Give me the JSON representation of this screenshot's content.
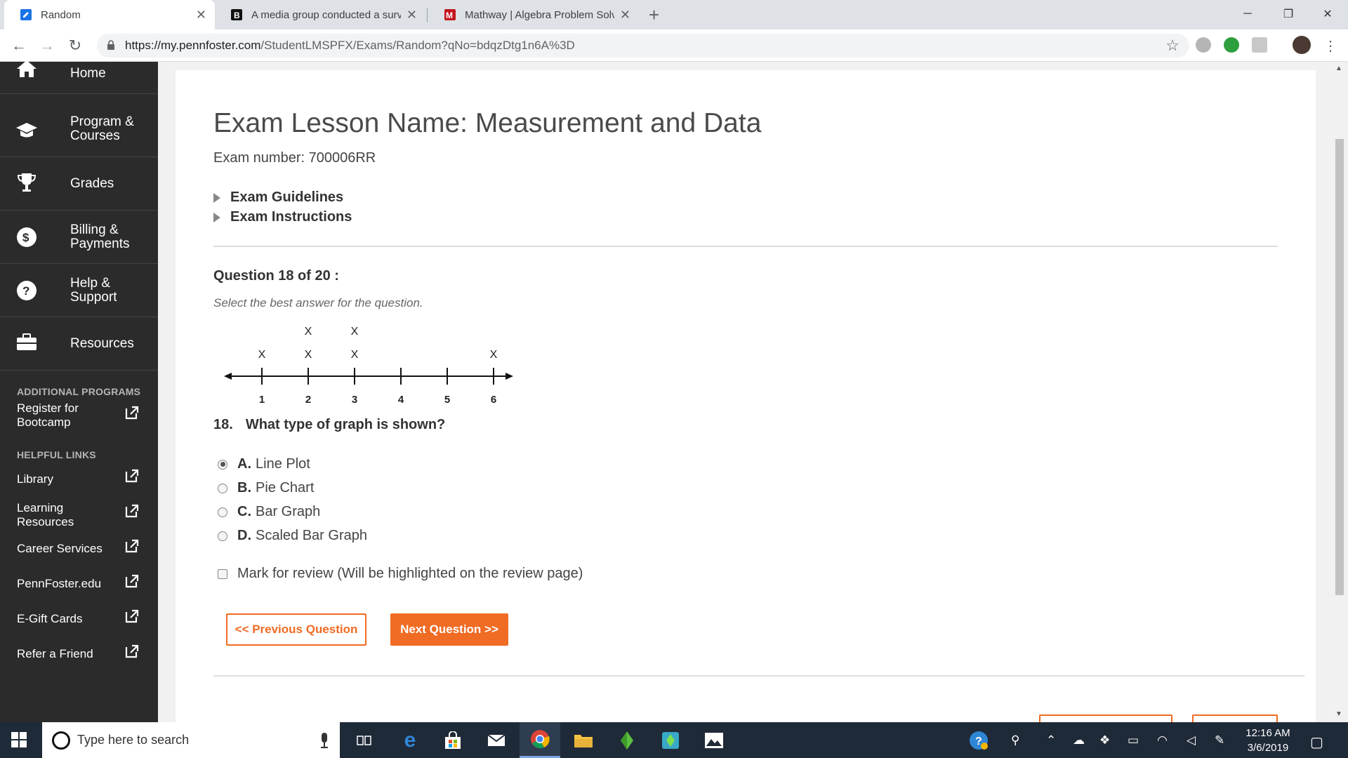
{
  "browser": {
    "tabs": [
      {
        "title": "Random",
        "active": true
      },
      {
        "title": "A media group conducted a surv",
        "active": false
      },
      {
        "title": "Mathway | Algebra Problem Solv",
        "active": false
      }
    ],
    "url_host": "https://my.pennfoster.com",
    "url_path": "/StudentLMSPFX/Exams/Random?qNo=bdqzDtg1n6A%3D"
  },
  "sidebar": {
    "nav": [
      {
        "label": "Home",
        "icon": "home-icon"
      },
      {
        "label": "Program & Courses",
        "icon": "graduation-cap-icon"
      },
      {
        "label": "Grades",
        "icon": "trophy-icon"
      },
      {
        "label": "Billing & Payments",
        "icon": "dollar-icon"
      },
      {
        "label": "Help & Support",
        "icon": "question-icon"
      },
      {
        "label": "Resources",
        "icon": "briefcase-icon"
      }
    ],
    "additional_heading": "ADDITIONAL PROGRAMS",
    "bootcamp": "Register for Bootcamp",
    "helpful_heading": "HELPFUL LINKS",
    "links": [
      "Library",
      "Learning Resources",
      "Career Services",
      "PennFoster.edu",
      "E-Gift Cards",
      "Refer a Friend"
    ]
  },
  "exam": {
    "title": "Exam Lesson Name: Measurement and Data",
    "number": "Exam number: 700006RR",
    "guidelines": "Exam Guidelines",
    "instructions": "Exam Instructions",
    "question_header": "Question 18 of 20 :",
    "instruction_text": "Select the best answer for the question.",
    "question_number": "18.",
    "question_text": "What type of graph is shown?",
    "options": [
      {
        "letter": "A.",
        "text": "Line Plot",
        "selected": true
      },
      {
        "letter": "B.",
        "text": "Pie Chart",
        "selected": false
      },
      {
        "letter": "C.",
        "text": "Bar Graph",
        "selected": false
      },
      {
        "letter": "D.",
        "text": "Scaled Bar Graph",
        "selected": false
      }
    ],
    "review_label": "Mark for review (Will be highlighted on the review page)",
    "prev_label": "<< Previous Question",
    "next_label": "Next Question >>"
  },
  "line_plot": {
    "ticks": [
      "1",
      "2",
      "3",
      "4",
      "5",
      "6"
    ],
    "counts": [
      1,
      2,
      2,
      0,
      0,
      1
    ],
    "mark": "X"
  },
  "taskbar": {
    "search_placeholder": "Type here to search",
    "time": "12:16 AM",
    "date": "3/6/2019"
  },
  "colors": {
    "accent": "#f06b23",
    "sidebar_bg": "#2b2b2b",
    "taskbar_bg": "#1f2a38"
  }
}
